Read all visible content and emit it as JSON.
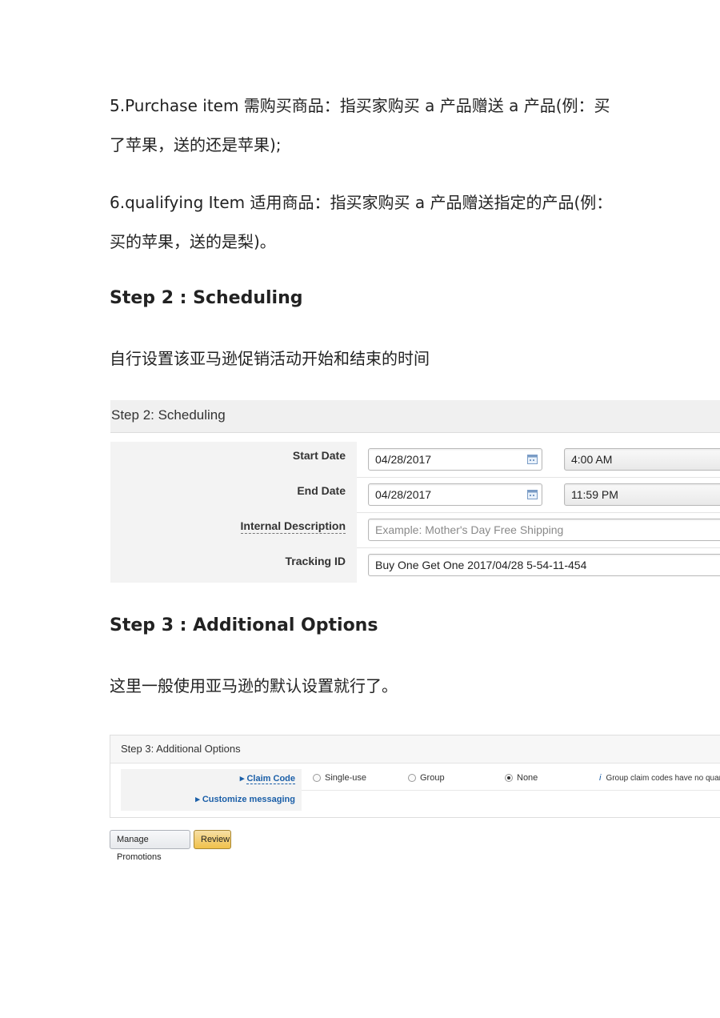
{
  "article": {
    "item5_line1": "5.Purchase item 需购买商品：指买家购买 a 产品赠送 a 产品(例：买",
    "item5_line2": "了苹果，送的还是苹果);",
    "item6_line1": "6.qualifying Item 适用商品：指买家购买 a 产品赠送指定的产品(例：",
    "item6_line2": "买的苹果，送的是梨)。",
    "step2_heading": "Step 2 : Scheduling",
    "step2_text": "自行设置该亚马逊促销活动开始和结束的时间",
    "step3_heading": "Step 3 : Additional Options",
    "step3_text": "这里一般使用亚马逊的默认设置就行了。"
  },
  "scheduling": {
    "title": "Step 2: Scheduling",
    "start_date_label": "Start Date",
    "start_date_value": "04/28/2017",
    "start_time_value": "4:00 AM",
    "end_date_label": "End Date",
    "end_date_value": "04/28/2017",
    "end_time_value": "11:59 PM",
    "internal_description_label": "Internal Description",
    "internal_description_placeholder": "Example: Mother's Day Free Shipping",
    "tracking_id_label": "Tracking ID",
    "tracking_id_value": "Buy One Get One 2017/04/28 5-54-11-454",
    "calendar_icon": "calendar-icon"
  },
  "additional_options": {
    "title": "Step 3: Additional Options",
    "claim_code_label": "Claim Code",
    "radio_single_use": "Single-use",
    "radio_group": "Group",
    "radio_none": "None",
    "selected_option": "None",
    "info_text": "Group claim codes have no quantity",
    "customize_messaging_label": "Customize messaging"
  },
  "buttons": {
    "manage_promotions": "Manage Promotions",
    "review": "Review"
  }
}
